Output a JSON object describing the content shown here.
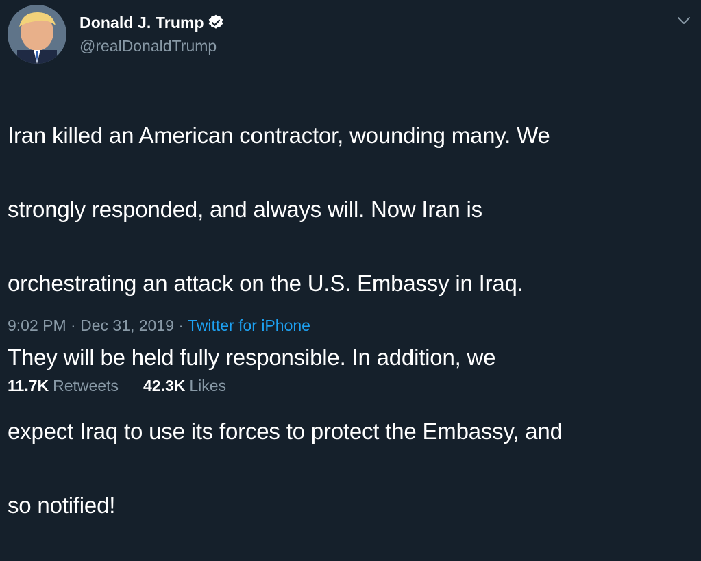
{
  "author": {
    "display_name": "Donald J. Trump",
    "handle": "@realDonaldTrump",
    "verified": true
  },
  "tweet": {
    "lines": [
      "Iran killed an American contractor, wounding many. We",
      "strongly responded, and always will. Now Iran is",
      "orchestrating an attack on the U.S. Embassy in Iraq.",
      "They will be held fully responsible. In addition, we",
      "expect Iraq to use its forces to protect the Embassy, and",
      "so notified!"
    ]
  },
  "meta": {
    "time": "9:02 PM",
    "separator": " · ",
    "date": "Dec 31, 2019",
    "source": "Twitter for iPhone"
  },
  "stats": {
    "retweets_count": "11.7K",
    "retweets_label": "Retweets",
    "likes_count": "42.3K",
    "likes_label": "Likes"
  },
  "colors": {
    "background": "#15202b",
    "text": "#ffffff",
    "secondary": "#8899a6",
    "accent": "#1da1f2",
    "divider": "#38444d"
  },
  "icons": {
    "verified": "verified-badge-icon",
    "caret": "chevron-down-icon"
  }
}
